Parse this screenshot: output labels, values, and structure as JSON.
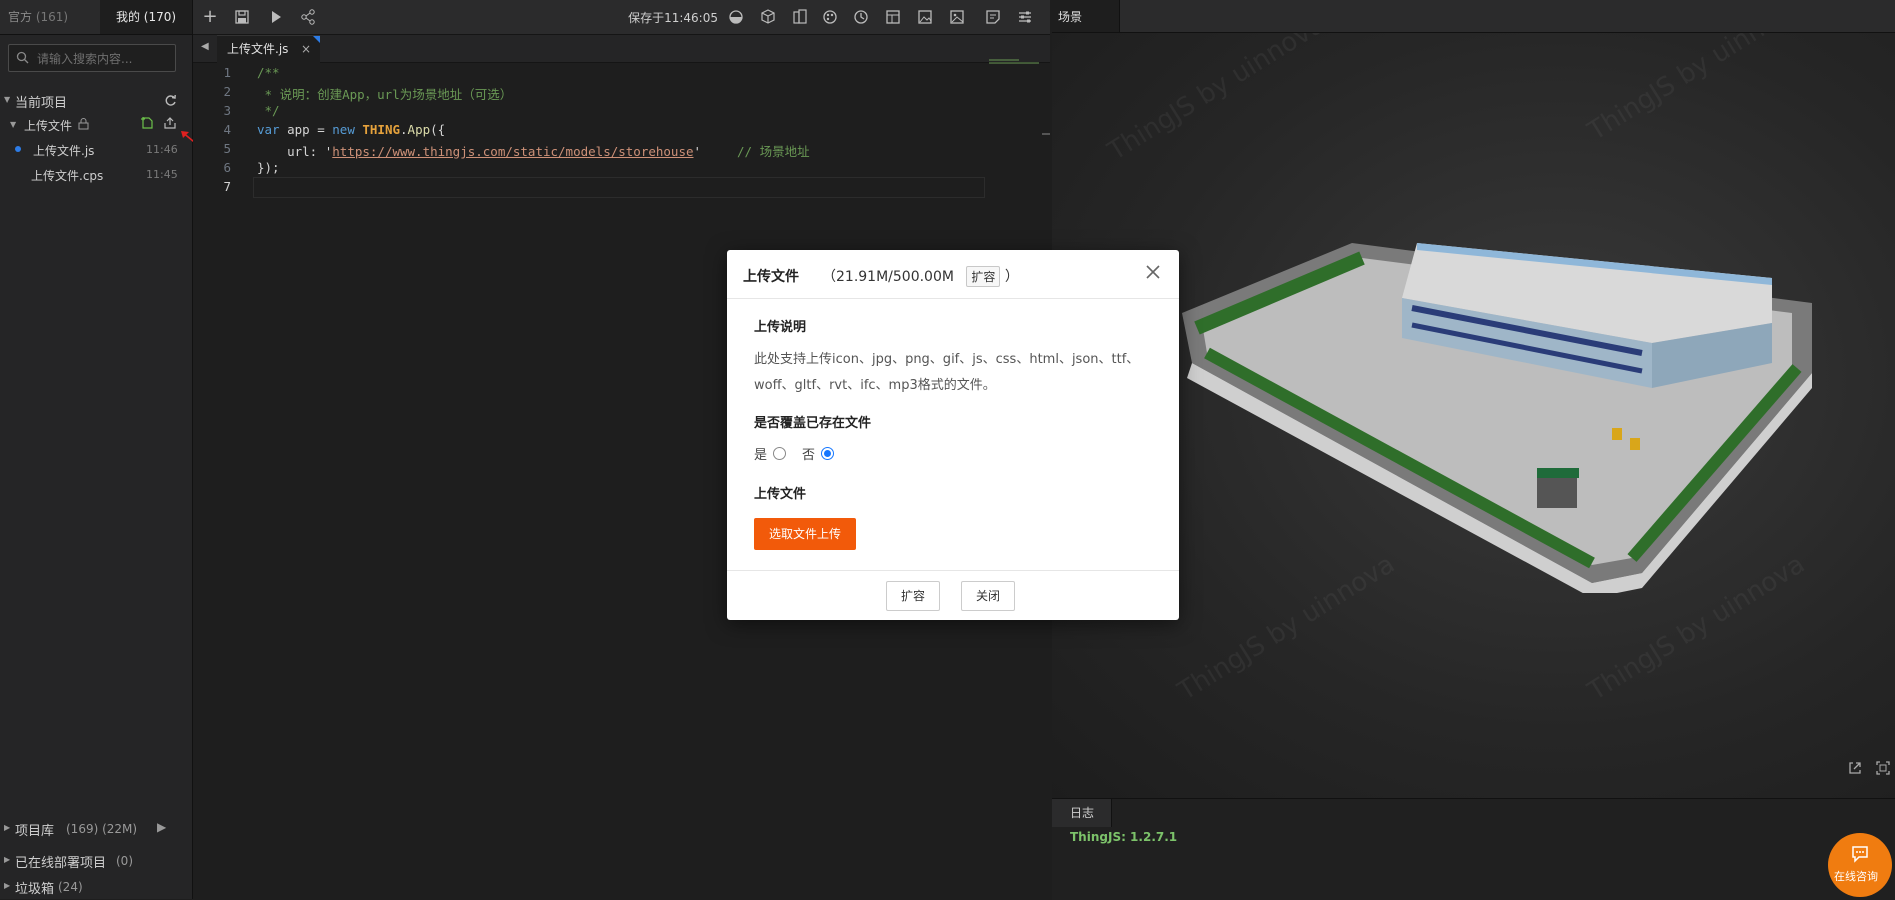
{
  "sidebar": {
    "tabs": [
      {
        "label": "官方",
        "count": "(161)"
      },
      {
        "label": "我的",
        "count": "(170)"
      }
    ],
    "search_placeholder": "请输入搜索内容...",
    "current_project": "当前项目",
    "folder": "上传文件",
    "files": [
      {
        "name": "上传文件.js",
        "time": "11:46"
      },
      {
        "name": "上传文件.cps",
        "time": "11:45"
      }
    ],
    "bottom": [
      {
        "label": "项目库",
        "extra": "(169) (22M)"
      },
      {
        "label": "已在线部署项目",
        "extra": "(0)"
      },
      {
        "label": "垃圾箱",
        "extra": "(24)"
      }
    ]
  },
  "toolbar": {
    "saved_text": "保存于11:46:05"
  },
  "editor": {
    "tab_label": "上传文件.js",
    "tab_close": "×",
    "line_numbers": [
      "1",
      "2",
      "3",
      "4",
      "5",
      "6",
      "7"
    ],
    "lines": {
      "l1": "/**",
      "l2": " * 说明：创建App，url为场景地址（可选）",
      "l3": " */",
      "l4_kw": "var",
      "l4_a": " app = ",
      "l4_new": "new",
      "l4_cls": "THING",
      "l4_b": ".",
      "l4_fn": "App",
      "l4_c": "({",
      "l5_a": "    url: '",
      "l5_str": "https://www.thingjs.com/static/models/storehouse",
      "l5_b": "'",
      "l5_com": "// 场景地址",
      "l6": "});"
    }
  },
  "scene": {
    "tab_label": "场景",
    "watermark": "ThingJS by uinnova"
  },
  "log": {
    "tab_label": "日志",
    "line": "ThingJS: 1.2.7.1"
  },
  "modal": {
    "title": "上传文件",
    "quota_open": "（21.91M/500.00M",
    "expand_small": "扩容",
    "quota_close": "）",
    "section_desc_title": "上传说明",
    "desc": "此处支持上传icon、jpg、png、gif、js、css、html、json、ttf、woff、gltf、rvt、ifc、mp3格式的文件。",
    "section_overwrite": "是否覆盖已存在文件",
    "yes": "是",
    "no": "否",
    "section_upload": "上传文件",
    "upload_button": "选取文件上传",
    "footer_expand": "扩容",
    "footer_close": "关闭"
  },
  "chat": {
    "label": "在线咨询"
  },
  "colors": {
    "accent_orange": "#f25a0a",
    "chat_orange": "#f07c10",
    "radio_blue": "#1677ff",
    "log_green": "#7cc26a"
  }
}
